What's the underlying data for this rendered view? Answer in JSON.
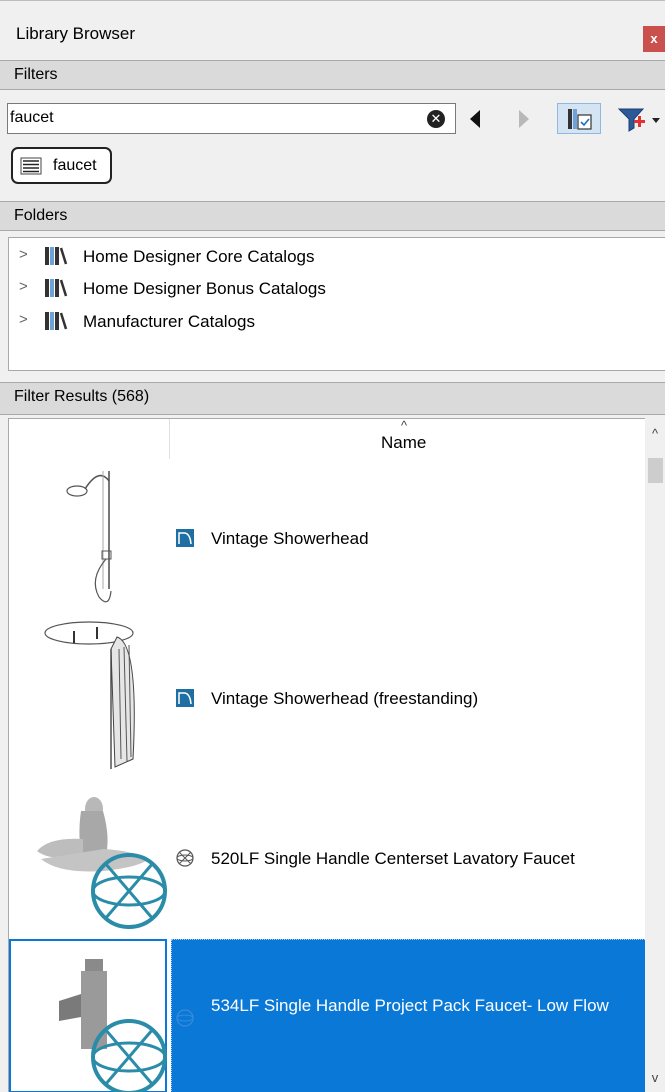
{
  "window": {
    "title": "Library Browser",
    "close_label": "x"
  },
  "filters": {
    "header": "Filters",
    "search_value": "faucet",
    "active_filter_chip": "faucet"
  },
  "folders": {
    "header": "Folders",
    "items": [
      {
        "label": "Home Designer Core Catalogs"
      },
      {
        "label": "Home Designer Bonus Catalogs"
      },
      {
        "label": "Manufacturer Catalogs"
      }
    ]
  },
  "results": {
    "header": "Filter Results (568)",
    "column_name": "Name",
    "rows": [
      {
        "label": "Vintage Showerhead",
        "type_icon": "library-object-icon",
        "selected": false
      },
      {
        "label": "Vintage Showerhead (freestanding)",
        "type_icon": "library-object-icon",
        "selected": false
      },
      {
        "label": "520LF Single Handle Centerset Lavatory Faucet",
        "type_icon": "web-object-icon",
        "selected": false
      },
      {
        "label": "534LF Single Handle Project Pack Faucet- Low Flow",
        "type_icon": "web-object-icon",
        "selected": true
      }
    ]
  },
  "colors": {
    "selection": "#0a78d7",
    "close_button": "#c9504d",
    "section_header": "#dadada"
  }
}
